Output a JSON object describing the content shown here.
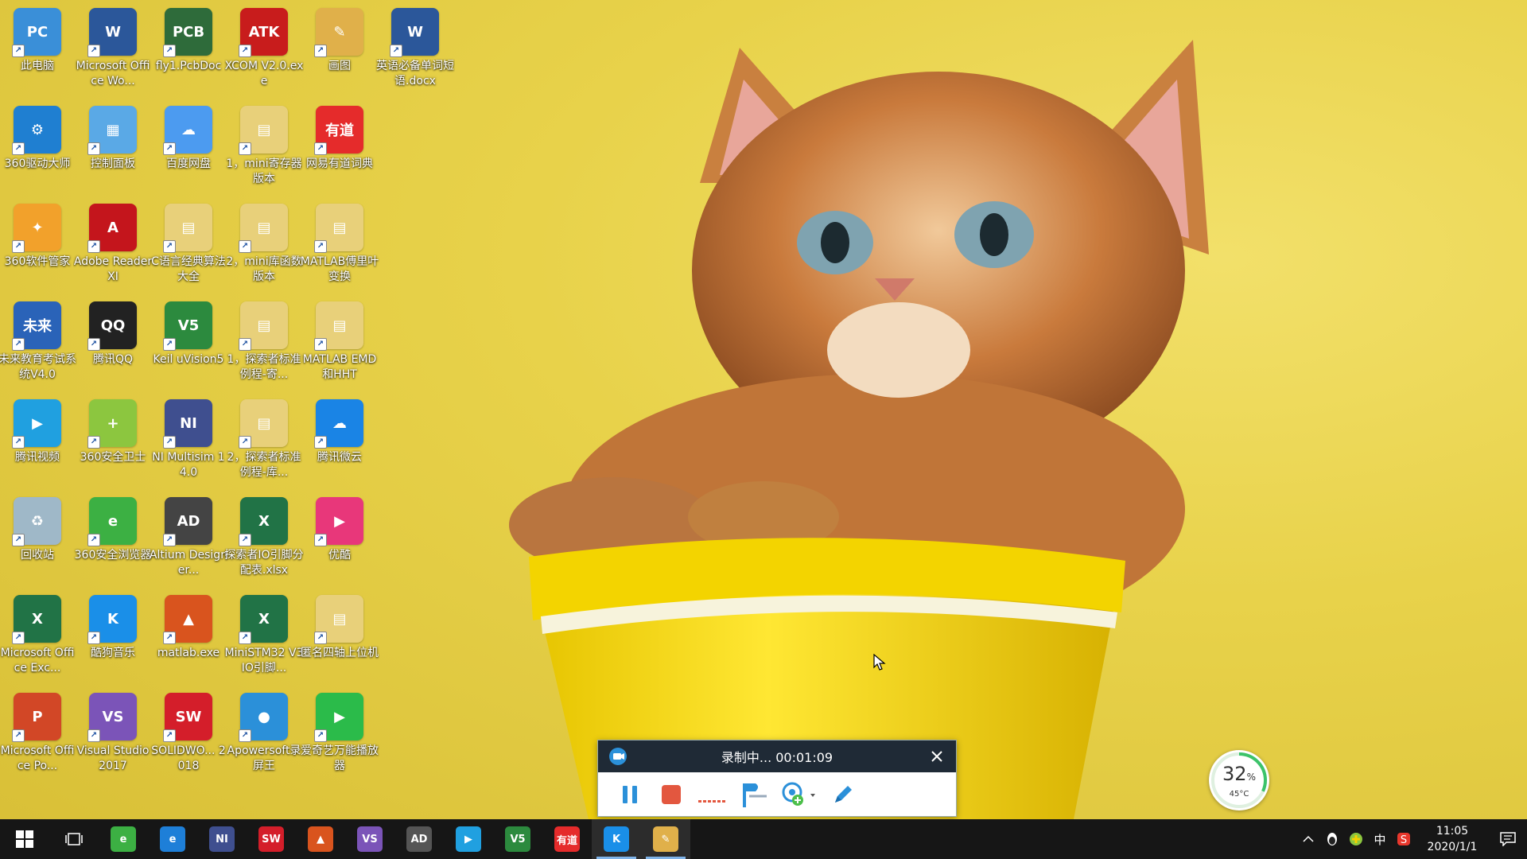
{
  "desktop": {
    "icons": [
      {
        "label": "此电脑",
        "glyph": "PC",
        "color": "#3a8fd8"
      },
      {
        "label": "Microsoft Office Wo...",
        "glyph": "W",
        "color": "#2b579a"
      },
      {
        "label": "fly1.PcbDoc",
        "glyph": "PCB",
        "color": "#2e6b3a"
      },
      {
        "label": "XCOM V2.0.exe",
        "glyph": "ATK",
        "color": "#c81c1c"
      },
      {
        "label": "画图",
        "glyph": "✎",
        "color": "#e0b04a"
      },
      {
        "label": "英语必备单词短语.docx",
        "glyph": "W",
        "color": "#2b579a"
      },
      {
        "label": "360驱动大师",
        "glyph": "⚙",
        "color": "#1f7fd1"
      },
      {
        "label": "控制面板",
        "glyph": "▦",
        "color": "#5aa9e6"
      },
      {
        "label": "百度网盘",
        "glyph": "☁",
        "color": "#4c9bf0"
      },
      {
        "label": "1，mini寄存器版本",
        "glyph": "▤",
        "color": "#e8d07a"
      },
      {
        "label": "网易有道词典",
        "glyph": "有道",
        "color": "#e52b2b"
      },
      {
        "label": "360软件管家",
        "glyph": "✦",
        "color": "#f2a12b"
      },
      {
        "label": "Adobe Reader XI",
        "glyph": "A",
        "color": "#c4151c"
      },
      {
        "label": "C语言经典算法大全",
        "glyph": "▤",
        "color": "#e8d07a"
      },
      {
        "label": "2，mini库函数版本",
        "glyph": "▤",
        "color": "#e8d07a"
      },
      {
        "label": "MATLAB傅里叶变换",
        "glyph": "▤",
        "color": "#e8d07a"
      },
      {
        "label": "未来教育考试系统V4.0",
        "glyph": "未来",
        "color": "#2a63b8"
      },
      {
        "label": "腾讯QQ",
        "glyph": "QQ",
        "color": "#222222"
      },
      {
        "label": "Keil uVision5",
        "glyph": "V5",
        "color": "#2c8a3e"
      },
      {
        "label": "1，探索者标准例程-寄...",
        "glyph": "▤",
        "color": "#e8d07a"
      },
      {
        "label": "MATLAB EMD和HHT",
        "glyph": "▤",
        "color": "#e8d07a"
      },
      {
        "label": "腾讯视频",
        "glyph": "▶",
        "color": "#20a0e0"
      },
      {
        "label": "360安全卫士",
        "glyph": "+",
        "color": "#8cc63f"
      },
      {
        "label": "NI Multisim 14.0",
        "glyph": "NI",
        "color": "#3f4f8f"
      },
      {
        "label": "2，探索者标准例程-库...",
        "glyph": "▤",
        "color": "#e8d07a"
      },
      {
        "label": "腾讯微云",
        "glyph": "☁",
        "color": "#1a84e5"
      },
      {
        "label": "回收站",
        "glyph": "♻",
        "color": "#9fb8c8"
      },
      {
        "label": "360安全浏览器",
        "glyph": "e",
        "color": "#3cb043"
      },
      {
        "label": "Altium Designer...",
        "glyph": "AD",
        "color": "#444444"
      },
      {
        "label": "探索者IO引脚分配表.xlsx",
        "glyph": "X",
        "color": "#217346"
      },
      {
        "label": "优酷",
        "glyph": "▶",
        "color": "#e8377a"
      },
      {
        "label": "Microsoft Office Exc...",
        "glyph": "X",
        "color": "#217346"
      },
      {
        "label": "酷狗音乐",
        "glyph": "K",
        "color": "#1a8fe8"
      },
      {
        "label": "matlab.exe",
        "glyph": "▲",
        "color": "#d9541e"
      },
      {
        "label": "MiniSTM32 V3 IO引脚...",
        "glyph": "X",
        "color": "#217346"
      },
      {
        "label": "匿名四轴上位机",
        "glyph": "▤",
        "color": "#e8d07a"
      },
      {
        "label": "Microsoft Office Po...",
        "glyph": "P",
        "color": "#d24726"
      },
      {
        "label": "Visual Studio 2017",
        "glyph": "VS",
        "color": "#7b54b8"
      },
      {
        "label": "SOLIDWO... 2018",
        "glyph": "SW",
        "color": "#d41e2a"
      },
      {
        "label": "Apowersoft录屏王",
        "glyph": "●",
        "color": "#2b90d9"
      },
      {
        "label": "爱奇艺万能播放器",
        "glyph": "▶",
        "color": "#2bbb4a"
      }
    ]
  },
  "recorder": {
    "status": "录制中... 00:01:09"
  },
  "gauge": {
    "percent_number": "32",
    "percent_sign": "%",
    "temperature": "45°C"
  },
  "taskbar": {
    "apps": [
      {
        "name": "360-browser",
        "glyph": "e",
        "color": "#3cb043"
      },
      {
        "name": "edge",
        "glyph": "e",
        "color": "#1e7fd8"
      },
      {
        "name": "multisim",
        "glyph": "NI",
        "color": "#3f4f8f"
      },
      {
        "name": "solidworks",
        "glyph": "SW",
        "color": "#d41e2a"
      },
      {
        "name": "matlab",
        "glyph": "▲",
        "color": "#d9541e"
      },
      {
        "name": "visual-studio",
        "glyph": "VS",
        "color": "#7b54b8"
      },
      {
        "name": "altium",
        "glyph": "AD",
        "color": "#555555"
      },
      {
        "name": "tencent-video",
        "glyph": "▶",
        "color": "#20a0e0"
      },
      {
        "name": "keil",
        "glyph": "V5",
        "color": "#2c8a3e"
      },
      {
        "name": "youdao",
        "glyph": "有道",
        "color": "#e52b2b"
      },
      {
        "name": "kugou",
        "glyph": "K",
        "color": "#1a8fe8"
      },
      {
        "name": "paint",
        "glyph": "✎",
        "color": "#e0b04a"
      }
    ],
    "tray": {
      "ime_label": "中",
      "time": "11:05",
      "date": "2020/1/1"
    }
  }
}
